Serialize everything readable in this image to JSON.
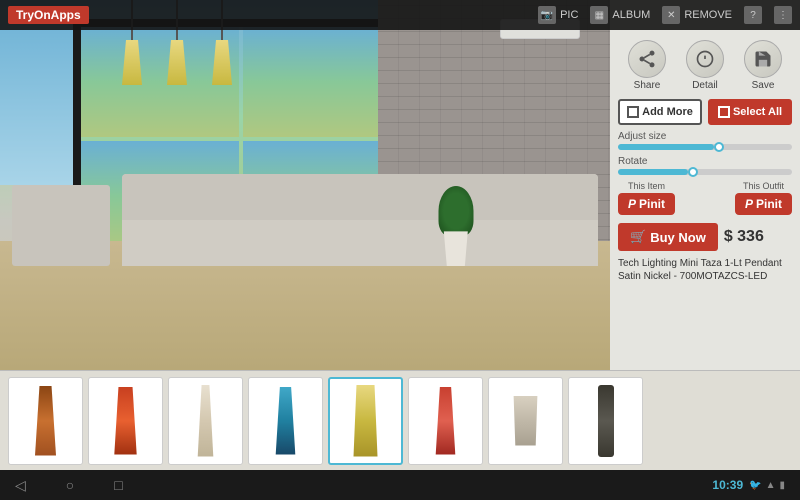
{
  "app": {
    "brand": "TryOnApps"
  },
  "toolbar": {
    "pic_label": "PIC",
    "album_label": "ALBUM",
    "remove_label": "REMOVE"
  },
  "panel": {
    "share_label": "Share",
    "detail_label": "Detail",
    "save_label": "Save",
    "add_more_label": "Add More",
    "select_all_label": "Select All",
    "adjust_size_label": "Adjust size",
    "rotate_label": "Rotate",
    "this_item_label": "This Item",
    "this_outfit_label": "This Outfit",
    "pinit_label": "Pinit",
    "buy_now_label": "Buy Now",
    "price": "$ 336",
    "product_name": "Tech Lighting Mini Taza 1-Lt Pendant Satin Nickel - 700MOTAZCS-LED",
    "adjust_size_value": 55,
    "rotate_value": 40
  },
  "thumbnails": [
    {
      "id": 1,
      "lamp_class": "lamp-1",
      "selected": false
    },
    {
      "id": 2,
      "lamp_class": "lamp-2",
      "selected": false
    },
    {
      "id": 3,
      "lamp_class": "lamp-3",
      "selected": false
    },
    {
      "id": 4,
      "lamp_class": "lamp-4",
      "selected": false
    },
    {
      "id": 5,
      "lamp_class": "lamp-5",
      "selected": true
    },
    {
      "id": 6,
      "lamp_class": "lamp-6",
      "selected": false
    },
    {
      "id": 7,
      "lamp_class": "lamp-7",
      "selected": false
    },
    {
      "id": 8,
      "lamp_class": "lamp-8",
      "selected": false
    }
  ],
  "android": {
    "time": "10:39",
    "nav_back": "◁",
    "nav_home": "○",
    "nav_recents": "□"
  }
}
